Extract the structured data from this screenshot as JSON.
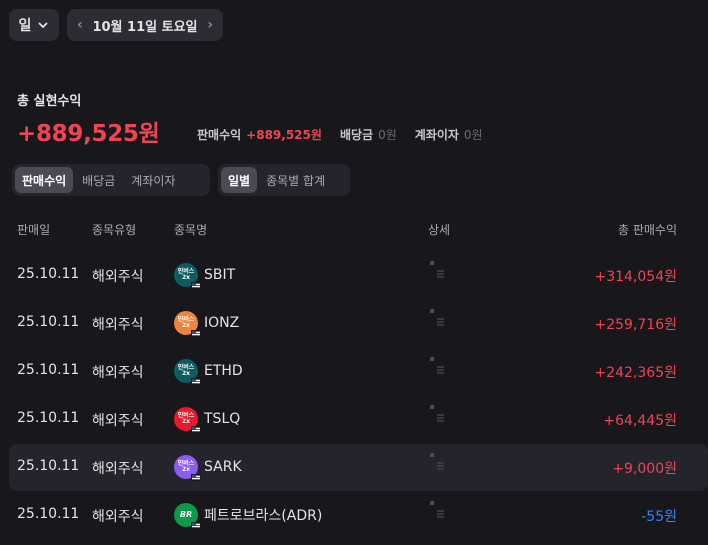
{
  "toolbar": {
    "period": "일",
    "date": "10월 11일 토요일"
  },
  "summary": {
    "title": "총 실현수익",
    "total": "+889,525원",
    "sales_label": "판매수익",
    "sales_value": "+889,525원",
    "dividend_label": "배당금",
    "dividend_value": "0원",
    "interest_label": "계좌이자",
    "interest_value": "0원"
  },
  "filters": {
    "type_tabs": [
      "판매수익",
      "배당금",
      "계좌이자"
    ],
    "view_tabs": [
      "일별",
      "종목별 합계"
    ]
  },
  "table": {
    "columns": [
      "판매일",
      "종목유형",
      "종목명",
      "상세",
      "총 판매수익"
    ],
    "rows": [
      {
        "date": "25.10.11",
        "type": "해외주식",
        "logo_text": "인버스 2x",
        "name": "SBIT",
        "amount": "+314,054원",
        "sign": "pos"
      },
      {
        "date": "25.10.11",
        "type": "해외주식",
        "logo_text": "인버스 2x",
        "name": "IONZ",
        "amount": "+259,716원",
        "sign": "pos"
      },
      {
        "date": "25.10.11",
        "type": "해외주식",
        "logo_text": "인버스 2x",
        "name": "ETHD",
        "amount": "+242,365원",
        "sign": "pos"
      },
      {
        "date": "25.10.11",
        "type": "해외주식",
        "logo_text": "인버스 2x",
        "name": "TSLQ",
        "amount": "+64,445원",
        "sign": "pos"
      },
      {
        "date": "25.10.11",
        "type": "해외주식",
        "logo_text": "인버스 2x",
        "name": "SARK",
        "amount": "+9,000원",
        "sign": "pos"
      },
      {
        "date": "25.10.11",
        "type": "해외주식",
        "logo_text": "BR",
        "name": "페트로브라스(ADR)",
        "amount": "-55원",
        "sign": "neg"
      }
    ]
  },
  "colors": {
    "positive": "#f04452",
    "negative": "#3182f6",
    "logo_sbit": "#0d5c63",
    "logo_ionz": "#f0843c",
    "logo_ethd": "#0d5c63",
    "logo_tslq": "#e8192c",
    "logo_sark": "#8a5cf0",
    "logo_br": "#0a9a48"
  },
  "icons": {
    "period_dropdown": "chevron-down-icon",
    "prev": "chevron-left-icon",
    "next": "chevron-right-icon",
    "detail": "document-icon",
    "flag": "us-flag-icon"
  }
}
